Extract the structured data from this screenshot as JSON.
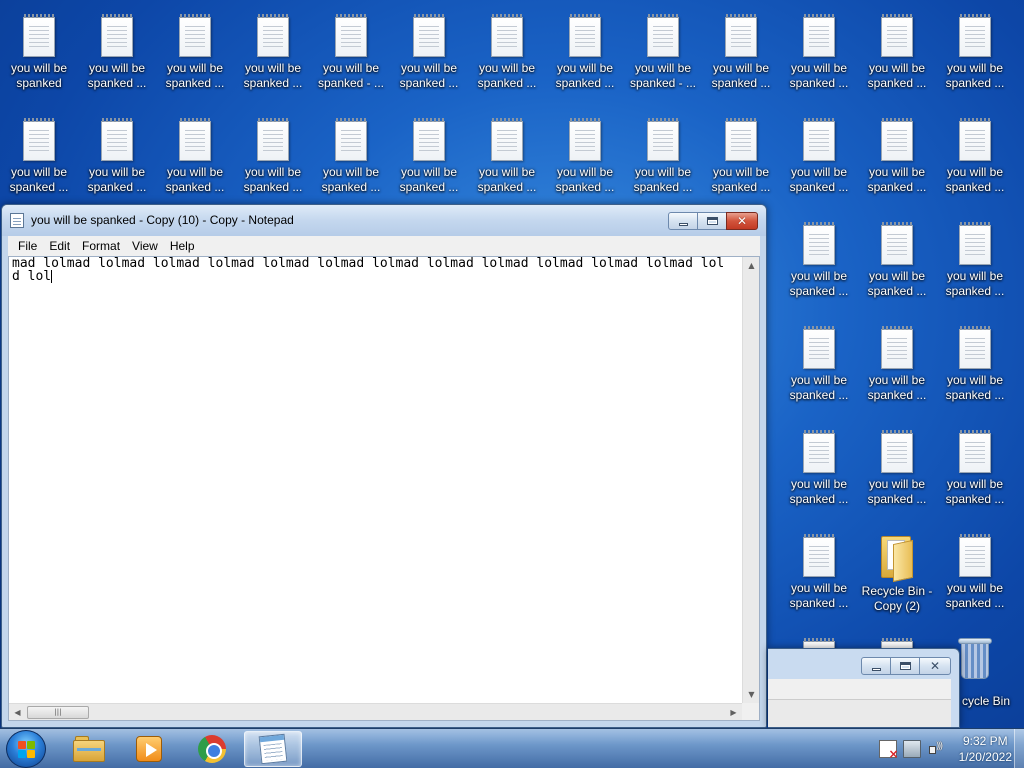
{
  "desktop": {
    "icon_labels": {
      "you_will_be_spanked": "you will be\nspanked",
      "you_will_be_spanked_trunc": "you will be\nspanked ...",
      "you_will_be_spanked_copy_trunc": "you will be\nspanked - ...",
      "recycle_bin_copy_2": "Recycle Bin -\nCopy (2)",
      "recycle_bin_partial": "cycle Bin"
    }
  },
  "notepad": {
    "title": "you will be spanked - Copy (10) - Copy - Notepad",
    "menu": [
      "File",
      "Edit",
      "Format",
      "View",
      "Help"
    ],
    "content_line1": "mad lolmad lolmad lolmad lolmad lolmad lolmad lolmad lolmad lolmad lolmad lolmad lolmad lol",
    "content_line2": "d lol",
    "scroll_thumb_grip": "|||"
  },
  "window_buttons": {
    "close_glyph": "✕"
  },
  "taskbar": {
    "clock_time": "9:32 PM",
    "clock_date": "1/20/2022"
  },
  "colors": {
    "desktop_blue": "#1a63c6",
    "close_red": "#c23a24"
  }
}
